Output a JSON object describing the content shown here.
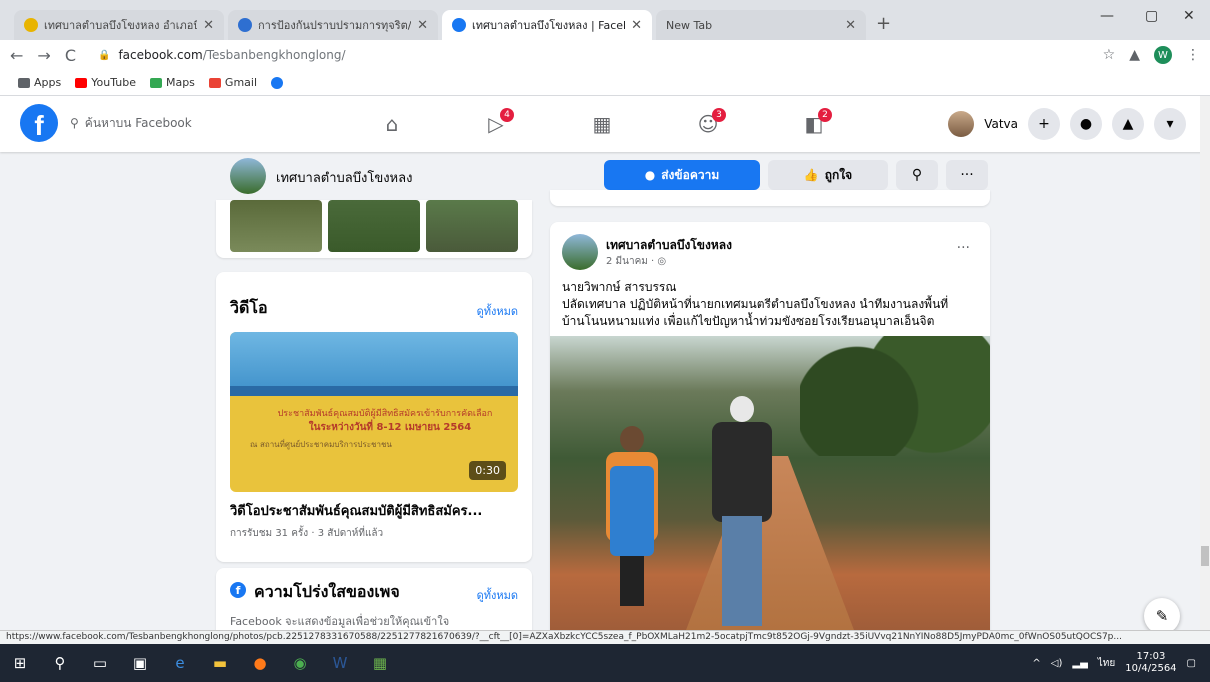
{
  "browser": {
    "tabs": [
      {
        "title": "เทศบาลตำบลบึงโขงหลง อำเภอบึงโขง",
        "active": false,
        "color": "#e8b400"
      },
      {
        "title": "การป้องกันปราบปรามการทุจริต/หน่วยงาน",
        "active": false,
        "color": "#2e6fd1"
      },
      {
        "title": "เทศบาลตำบลบึงโขงหลง | Facebook",
        "active": true,
        "color": "#1877f2"
      },
      {
        "title": "New Tab",
        "active": false,
        "color": ""
      }
    ],
    "url_host": "facebook.com",
    "url_path": "/Tesbanbengkhonglong/",
    "bookmarks": [
      {
        "label": "Apps",
        "color": "#5f6368"
      },
      {
        "label": "YouTube",
        "color": "#ff0000"
      },
      {
        "label": "Maps",
        "color": "#34a853"
      },
      {
        "label": "Gmail",
        "color": "#ea4335"
      },
      {
        "label": "",
        "color": "#1877f2"
      }
    ],
    "profile_initial": "W"
  },
  "fb": {
    "search_placeholder": "ค้นหาบน Facebook",
    "nav": [
      {
        "icon": "home-icon",
        "glyph": "⌂",
        "badge": ""
      },
      {
        "icon": "watch-icon",
        "glyph": "▷",
        "badge": "4"
      },
      {
        "icon": "marketplace-icon",
        "glyph": "▦",
        "badge": ""
      },
      {
        "icon": "groups-icon",
        "glyph": "☺",
        "badge": "3"
      },
      {
        "icon": "gaming-icon",
        "glyph": "◧",
        "badge": "2"
      }
    ],
    "user_name": "Vatva",
    "right_buttons": [
      {
        "icon": "plus-icon",
        "glyph": "+"
      },
      {
        "icon": "messenger-icon",
        "glyph": "●"
      },
      {
        "icon": "notifications-icon",
        "glyph": "▲"
      },
      {
        "icon": "account-menu-icon",
        "glyph": "▾"
      }
    ]
  },
  "page": {
    "name": "เทศบาลตำบลบึงโขงหลง",
    "message_label": "ส่งข้อความ",
    "like_label": "ถูกใจ"
  },
  "videos": {
    "heading": "วิดีโอ",
    "see_all": "ดูทั้งหมด",
    "thumb_line1": "ประชาสัมพันธ์คุณสมบัติผู้มีสิทธิสมัครเข้ารับการคัดเลือก",
    "thumb_line2": "ในระหว่างวันที่ 8-12 เมษายน 2564",
    "thumb_line3": "ณ สถานที่ศูนย์ประชาคมบริการประชาชน",
    "duration": "0:30",
    "title": "วิดีโอประชาสัมพันธ์คุณสมบัติผู้มีสิทธิสมัคร...",
    "meta": "การรับชม 31 ครั้ง · 3 สัปดาห์ที่แล้ว"
  },
  "transparency": {
    "heading": "ความโปร่งใสของเพจ",
    "see_all": "ดูทั้งหมด",
    "desc": "Facebook จะแสดงข้อมูลเพื่อช่วยให้คุณเข้าใจ"
  },
  "post": {
    "author": "เทศบาลตำบลบึงโขงหลง",
    "date": "2 มีนาคม · ◎",
    "line1": "นายวิพากษ์ สารบรรณ",
    "line2": "ปลัดเทศบาล ปฏิบัติหน้าที่นายกเทศมนตรีตำบลบึงโขงหลง นำทีมงานลงพื้นที่",
    "line3": "บ้านโนนหนามแท่ง เพื่อแก้ไขปัญหาน้ำท่วมขังซอยโรงเรียนอนุบาลเอ็นจิต"
  },
  "status_url": "https://www.facebook.com/Tesbanbengkhonglong/photos/pcb.2251278331670588/2251277821670639/?__cft__[0]=AZXaXbzkcYCC5szea_f_PbOXMLaH21m2-5ocatpjTmc9t852OGj-9Vgndzt-35iUVvq21NnYINo88D5JmyPDA0mc_0fWnOS05utQOCS7p...",
  "taskbar": {
    "time": "17:03",
    "date": "10/4/2564",
    "lang": "ไทย"
  }
}
